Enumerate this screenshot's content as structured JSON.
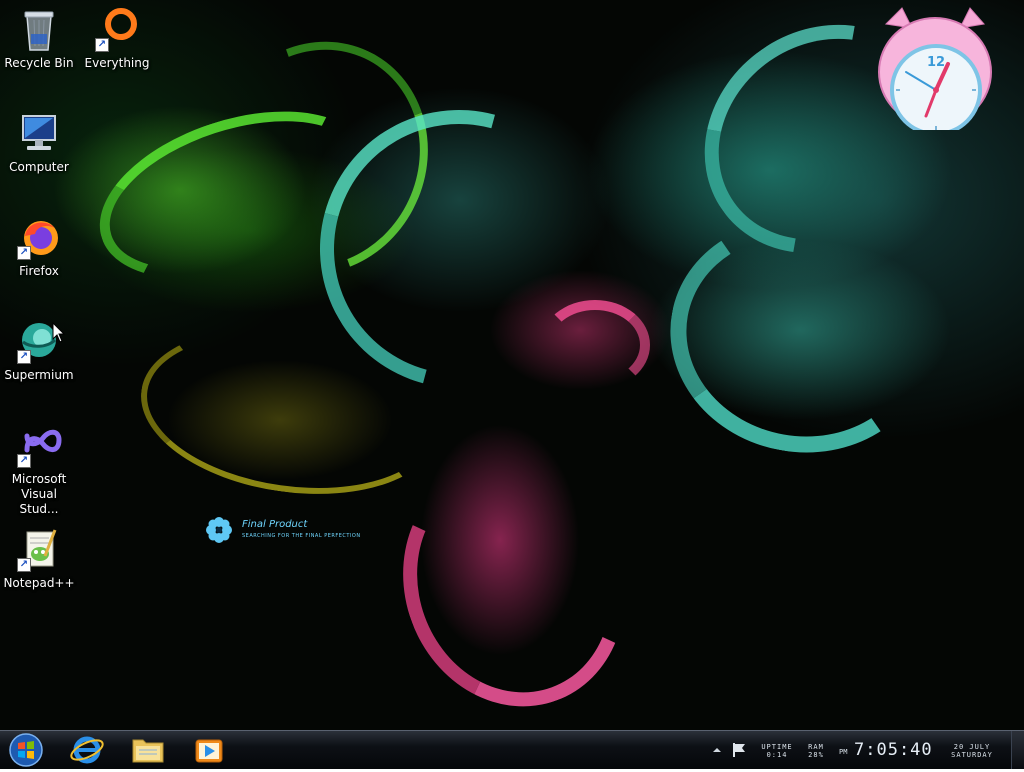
{
  "desktop": {
    "icons": [
      {
        "label": "Recycle Bin",
        "icon": "recycle-bin-icon",
        "shortcut": false
      },
      {
        "label": "Everything",
        "icon": "everything-icon",
        "shortcut": true
      },
      {
        "label": "Computer",
        "icon": "computer-icon",
        "shortcut": false
      },
      {
        "label": "Firefox",
        "icon": "firefox-icon",
        "shortcut": true
      },
      {
        "label": "Supermium",
        "icon": "supermium-icon",
        "shortcut": true
      },
      {
        "label": "Microsoft Visual Stud...",
        "icon": "visual-studio-icon",
        "shortcut": true
      },
      {
        "label": "Notepad++",
        "icon": "notepad-plus-plus-icon",
        "shortcut": true
      }
    ],
    "wallpaper_logo": {
      "title": "Final Product",
      "subtitle": "Searching for the final perfection"
    },
    "clock_gadget": {
      "dial_number": "12"
    }
  },
  "taskbar": {
    "start_icon": "windows-logo-icon",
    "pinned": [
      {
        "name": "Internet Explorer",
        "icon": "internet-explorer-icon"
      },
      {
        "name": "Windows Explorer",
        "icon": "folder-icon"
      },
      {
        "name": "Windows Media Player",
        "icon": "media-player-icon"
      }
    ],
    "tray": {
      "uptime_label": "UPTIME",
      "uptime_value": "0:14",
      "ram_label": "RAM",
      "ram_value": "28%",
      "ampm": "PM",
      "time": "7:05:40",
      "date": "20 JULY",
      "weekday": "SATURDAY"
    }
  },
  "colors": {
    "taskbar_bg": "#0d1015",
    "logo_text": "#6fd6ff",
    "icon_label": "#ffffff"
  }
}
